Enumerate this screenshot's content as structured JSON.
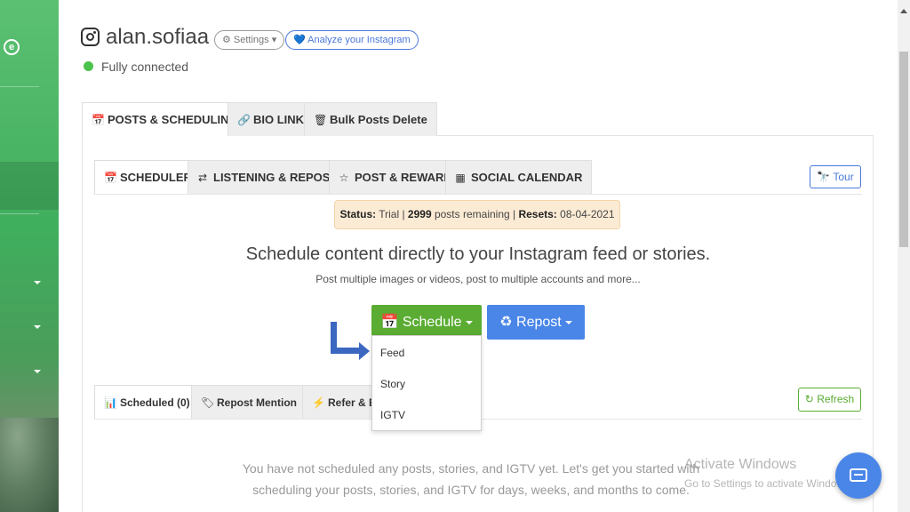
{
  "header": {
    "username": "alan.sofiaa",
    "settings_label": "⚙ Settings ▾",
    "analyze_label": "💙 Analyze your Instagram",
    "connection_status": "Fully connected"
  },
  "outer_tabs": [
    {
      "label": "POSTS & SCHEDULING",
      "icon": "calendar-check-icon"
    },
    {
      "label": "BIO LINK",
      "icon": "link-icon"
    },
    {
      "label": "Bulk Posts Delete",
      "icon": "trash-icon"
    }
  ],
  "inner_tabs": [
    {
      "label": "SCHEDULER",
      "icon": "calendar-check-icon"
    },
    {
      "label": "LISTENING & REPOST",
      "icon": "retweet-icon"
    },
    {
      "label": "POST & REWARD",
      "icon": "star-icon"
    },
    {
      "label": "SOCIAL CALENDAR",
      "icon": "calendar-icon"
    }
  ],
  "tour_label": "Tour",
  "status": {
    "status_label": "Status:",
    "status_value": " Trial | ",
    "posts_count": "2999",
    "posts_text": " posts remaining | ",
    "resets_label": "Resets:",
    "resets_value": " 08-04-2021"
  },
  "headline": "Schedule content directly to your Instagram feed or stories.",
  "subline": "Post multiple images or videos, post to multiple accounts and more...",
  "schedule_button": "Schedule",
  "repost_button": "Repost",
  "dropdown": [
    "Feed",
    "Story",
    "IGTV"
  ],
  "bottom_tabs": [
    {
      "label": "Scheduled (0)",
      "icon": "bar-chart-icon"
    },
    {
      "label": "Repost Mention",
      "icon": "tag-icon"
    },
    {
      "label": "Refer & Ea",
      "icon": "bolt-icon"
    }
  ],
  "refresh_label": "Refresh",
  "empty_message_1": "You have not scheduled any posts, stories, and IGTV yet. Let's get you started with",
  "empty_message_2": "scheduling your posts, stories, and IGTV for days, weeks, and months to come.",
  "watermark_title": "Activate Windows",
  "watermark_sub": "Go to Settings to activate Windows."
}
